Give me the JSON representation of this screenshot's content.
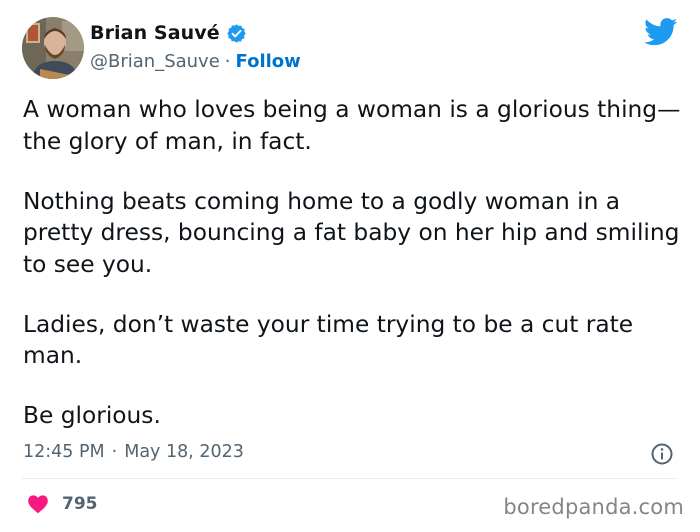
{
  "author": {
    "display_name": "Brian Sauvé",
    "handle": "@Brian_Sauve",
    "separator": "·",
    "follow_label": "Follow",
    "verified": true,
    "avatar_icon": "profile-photo"
  },
  "brand": {
    "icon": "twitter-bird-icon",
    "color": "#1d9bf0"
  },
  "tweet": {
    "paragraphs": [
      "A woman who loves being a woman is a glorious thing—the glory of man, in fact.",
      "Nothing beats coming home to a godly woman in a pretty dress, bouncing a fat baby on her hip and smiling to see you.",
      "Ladies, don’t waste your time trying to be a cut rate man.",
      "Be glorious."
    ],
    "time": "12:45 PM",
    "separator": "·",
    "date": "May 18, 2023"
  },
  "engagement": {
    "likes": "795",
    "like_icon": "heart-icon",
    "like_color": "#f91880",
    "info_icon": "info-icon"
  },
  "watermark": "boredpanda.com",
  "colors": {
    "text": "#0f1419",
    "secondary": "#536471",
    "link": "#0074cc",
    "divider": "#e6ecf0"
  }
}
